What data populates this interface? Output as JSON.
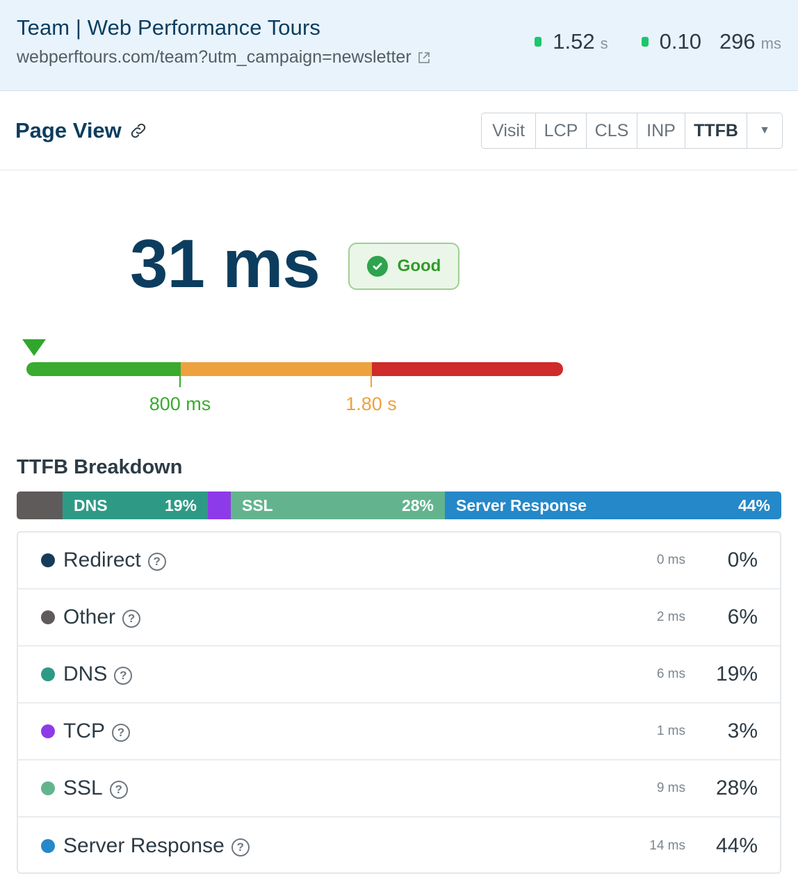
{
  "header": {
    "title": "Team | Web Performance Tours",
    "url": "webperftours.com/team?utm_campaign=newsletter",
    "metrics": [
      {
        "value": "1.52",
        "unit": "s",
        "status_color": "#1bc76a"
      },
      {
        "value": "0.10",
        "unit": "",
        "status_color": "#1bc76a"
      },
      {
        "value": "296",
        "unit": "ms"
      }
    ]
  },
  "toolbar": {
    "title": "Page View",
    "tabs": [
      "Visit",
      "LCP",
      "CLS",
      "INP",
      "TTFB"
    ],
    "active_tab": "TTFB"
  },
  "result": {
    "value": "31 ms",
    "rating": "Good",
    "rating_color": "#2f9c2a"
  },
  "thresholds": {
    "good_label": "800 ms",
    "poor_label": "1.80 s",
    "good_color": "#3aab2e",
    "needs_improvement_color": "#eda23f",
    "poor_color": "#cf2b2a",
    "marker_fraction": 0.0
  },
  "breakdown": {
    "title": "TTFB Breakdown",
    "rows": [
      {
        "label": "Redirect",
        "ms": "0 ms",
        "pct": "0%",
        "share": 0,
        "color": "#163c5a"
      },
      {
        "label": "Other",
        "ms": "2 ms",
        "pct": "6%",
        "share": 6,
        "color": "#5f5b5b"
      },
      {
        "label": "DNS",
        "ms": "6 ms",
        "pct": "19%",
        "share": 19,
        "color": "#2e9a86"
      },
      {
        "label": "TCP",
        "ms": "1 ms",
        "pct": "3%",
        "share": 3,
        "color": "#8d3be8"
      },
      {
        "label": "SSL",
        "ms": "9 ms",
        "pct": "28%",
        "share": 28,
        "color": "#63b48e"
      },
      {
        "label": "Server Response",
        "ms": "14 ms",
        "pct": "44%",
        "share": 44,
        "color": "#2588c8"
      }
    ]
  }
}
